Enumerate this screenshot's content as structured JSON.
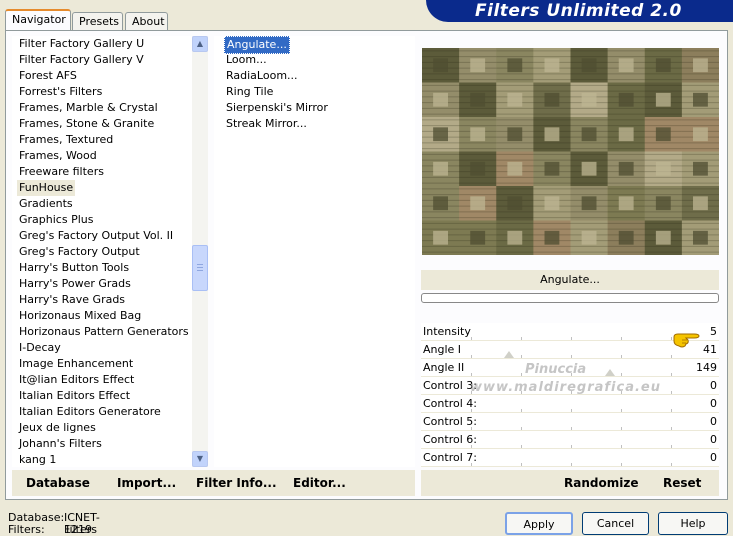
{
  "tabs": [
    {
      "label": "Navigator",
      "active": true
    },
    {
      "label": "Presets",
      "active": false
    },
    {
      "label": "About",
      "active": false
    }
  ],
  "banner_title": "Filters Unlimited 2.0",
  "categories": [
    "Filter Factory Gallery U",
    "Filter Factory Gallery V",
    "Forest AFS",
    "Forrest's Filters",
    "Frames, Marble & Crystal",
    "Frames, Stone & Granite",
    "Frames, Textured",
    "Frames, Wood",
    "Freeware filters",
    "FunHouse",
    "Gradients",
    "Graphics Plus",
    "Greg's Factory Output Vol. II",
    "Greg's Factory Output",
    "Harry's Button Tools",
    "Harry's Power Grads",
    "Harry's Rave Grads",
    "Horizonaus Mixed Bag",
    "Horizonaus Pattern Generators",
    "I-Decay",
    "Image Enhancement",
    "It@lian Editors Effect",
    "Italian Editors Effect",
    "Italian Editors Generatore",
    "Jeux de lignes",
    "Johann's Filters",
    "kang 1"
  ],
  "selected_category": "FunHouse",
  "filters": [
    "Angulate...",
    "Loom...",
    "RadiaLoom...",
    "Ring Tile",
    "Sierpenski's Mirror",
    "Streak Mirror..."
  ],
  "selected_filter": "Angulate...",
  "filter_name": "Angulate...",
  "progress": 0,
  "parameters": [
    {
      "label": "Intensity",
      "value": "5"
    },
    {
      "label": "Angle I",
      "value": "41"
    },
    {
      "label": "Angle II",
      "value": "149"
    },
    {
      "label": "Control 3:",
      "value": "0"
    },
    {
      "label": "Control 4:",
      "value": "0"
    },
    {
      "label": "Control 5:",
      "value": "0"
    },
    {
      "label": "Control 6:",
      "value": "0"
    },
    {
      "label": "Control 7:",
      "value": "0"
    }
  ],
  "left_buttons": {
    "database": "Database",
    "import": "Import...",
    "filter_info": "Filter Info...",
    "editor": "Editor..."
  },
  "right_buttons": {
    "randomize": "Randomize",
    "reset": "Reset"
  },
  "status": {
    "database_label": "Database:",
    "database_value": "ICNET-Filters",
    "filters_label": "Filters:",
    "filters_value": "1219"
  },
  "dialog_buttons": {
    "apply": "Apply",
    "cancel": "Cancel",
    "help": "Help"
  },
  "watermark": {
    "line1": "Pinuccia",
    "line2": "www.maldiregrafica.eu"
  },
  "colors": {
    "banner": "#0a2a8c",
    "selection": "#316ac5",
    "tab_accent": "#e68b2c"
  }
}
